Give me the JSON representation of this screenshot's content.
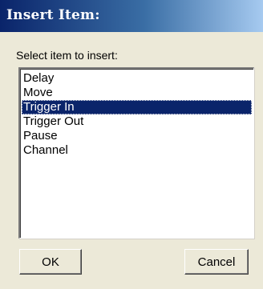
{
  "window": {
    "title": "Insert Item:"
  },
  "prompt": "Select item to insert:",
  "list": {
    "items": [
      {
        "label": "Delay",
        "selected": false
      },
      {
        "label": "Move",
        "selected": false
      },
      {
        "label": "Trigger In",
        "selected": true
      },
      {
        "label": "Trigger Out",
        "selected": false
      },
      {
        "label": "Pause",
        "selected": false
      },
      {
        "label": "Channel",
        "selected": false
      }
    ]
  },
  "buttons": {
    "ok_label": "OK",
    "cancel_label": "Cancel"
  },
  "colors": {
    "title_start": "#0a246a",
    "title_end": "#a6caf0",
    "selection": "#0a246a",
    "dialog_bg": "#ece9d8"
  }
}
